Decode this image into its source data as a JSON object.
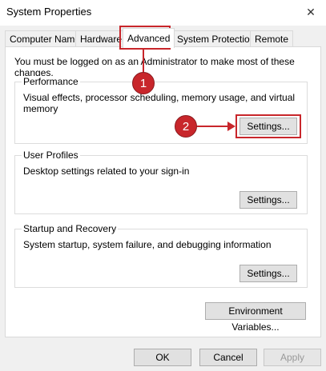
{
  "window": {
    "title": "System Properties",
    "close_glyph": "✕"
  },
  "tabs": [
    {
      "label": "Computer Name"
    },
    {
      "label": "Hardware"
    },
    {
      "label": "Advanced"
    },
    {
      "label": "System Protection"
    },
    {
      "label": "Remote"
    }
  ],
  "active_tab": "Advanced",
  "notice": "You must be logged on as an Administrator to make most of these changes.",
  "groups": {
    "performance": {
      "label": "Performance",
      "description": "Visual effects, processor scheduling, memory usage, and virtual memory",
      "button": "Settings..."
    },
    "user_profiles": {
      "label": "User Profiles",
      "description": "Desktop settings related to your sign-in",
      "button": "Settings..."
    },
    "startup": {
      "label": "Startup and Recovery",
      "description": "System startup, system failure, and debugging information",
      "button": "Settings..."
    }
  },
  "env_button": "Environment Variables...",
  "footer": {
    "ok": "OK",
    "cancel": "Cancel",
    "apply": "Apply"
  },
  "annotations": {
    "callout1": "1",
    "callout2": "2",
    "accent_color": "#c8262b"
  }
}
